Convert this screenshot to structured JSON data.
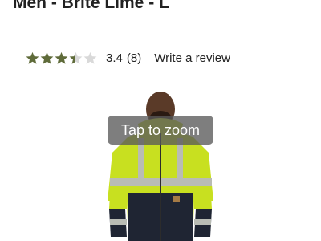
{
  "product": {
    "title": "Men - Brite Lime - L"
  },
  "rating": {
    "value": "3.4",
    "numeric_value": 3.4,
    "max_stars": 5,
    "count_text": "(8)",
    "write_review_label": "Write a review",
    "star_filled_color": "#5f6b3a",
    "star_empty_color": "#d9d9d9"
  },
  "image": {
    "icon": "jacket-model-image",
    "zoom_hint": "Tap to zoom",
    "colors": {
      "jacket_lime": "#c8e020",
      "reflective_stripe": "#b9bcb4",
      "jacket_dark": "#1f2533",
      "skin": "#5a3a28"
    }
  }
}
